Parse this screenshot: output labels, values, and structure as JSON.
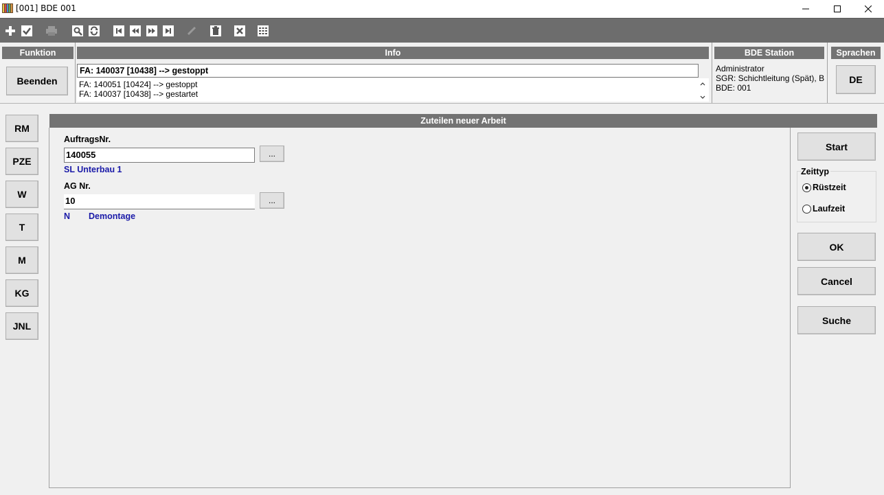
{
  "window": {
    "title": "[001] BDE 001"
  },
  "toolbar": {
    "icons": [
      "add-icon",
      "check-icon",
      "print-icon",
      "search-icon",
      "refresh-icon",
      "first-record-icon",
      "previous-record-icon",
      "next-record-icon",
      "last-record-icon",
      "edit-icon",
      "delete-icon",
      "close-icon",
      "grid-menu-icon"
    ]
  },
  "headers": {
    "funktion": "Funktion",
    "info": "Info",
    "station": "BDE Station",
    "sprachen": "Sprachen"
  },
  "funktion": {
    "beenden": "Beenden"
  },
  "info": {
    "current": "FA: 140037 [10438] --> gestoppt",
    "log": [
      "FA: 140051 [10424] --> gestoppt",
      "FA: 140037 [10438] --> gestartet"
    ]
  },
  "station": {
    "user": "Administrator",
    "group": "SGR: Schichtleitung (Spät), B",
    "bde": "BDE: 001"
  },
  "language": {
    "current": "DE"
  },
  "nav": [
    "RM",
    "PZE",
    "W",
    "T",
    "M",
    "KG",
    "JNL"
  ],
  "form": {
    "title": "Zuteilen neuer Arbeit",
    "auftrag_label": "AuftragsNr.",
    "auftrag_value": "140055",
    "auftrag_desc": "SL Unterbau 1",
    "ag_label": "AG Nr.",
    "ag_value": "10",
    "ag_code": "N",
    "ag_desc": "Demontage",
    "browse_label": "..."
  },
  "actions": {
    "start": "Start",
    "zeittyp_label": "Zeittyp",
    "ruestzeit": "Rüstzeit",
    "laufzeit": "Laufzeit",
    "selected_zeittyp": "Rüstzeit",
    "ok": "OK",
    "cancel": "Cancel",
    "suche": "Suche"
  }
}
